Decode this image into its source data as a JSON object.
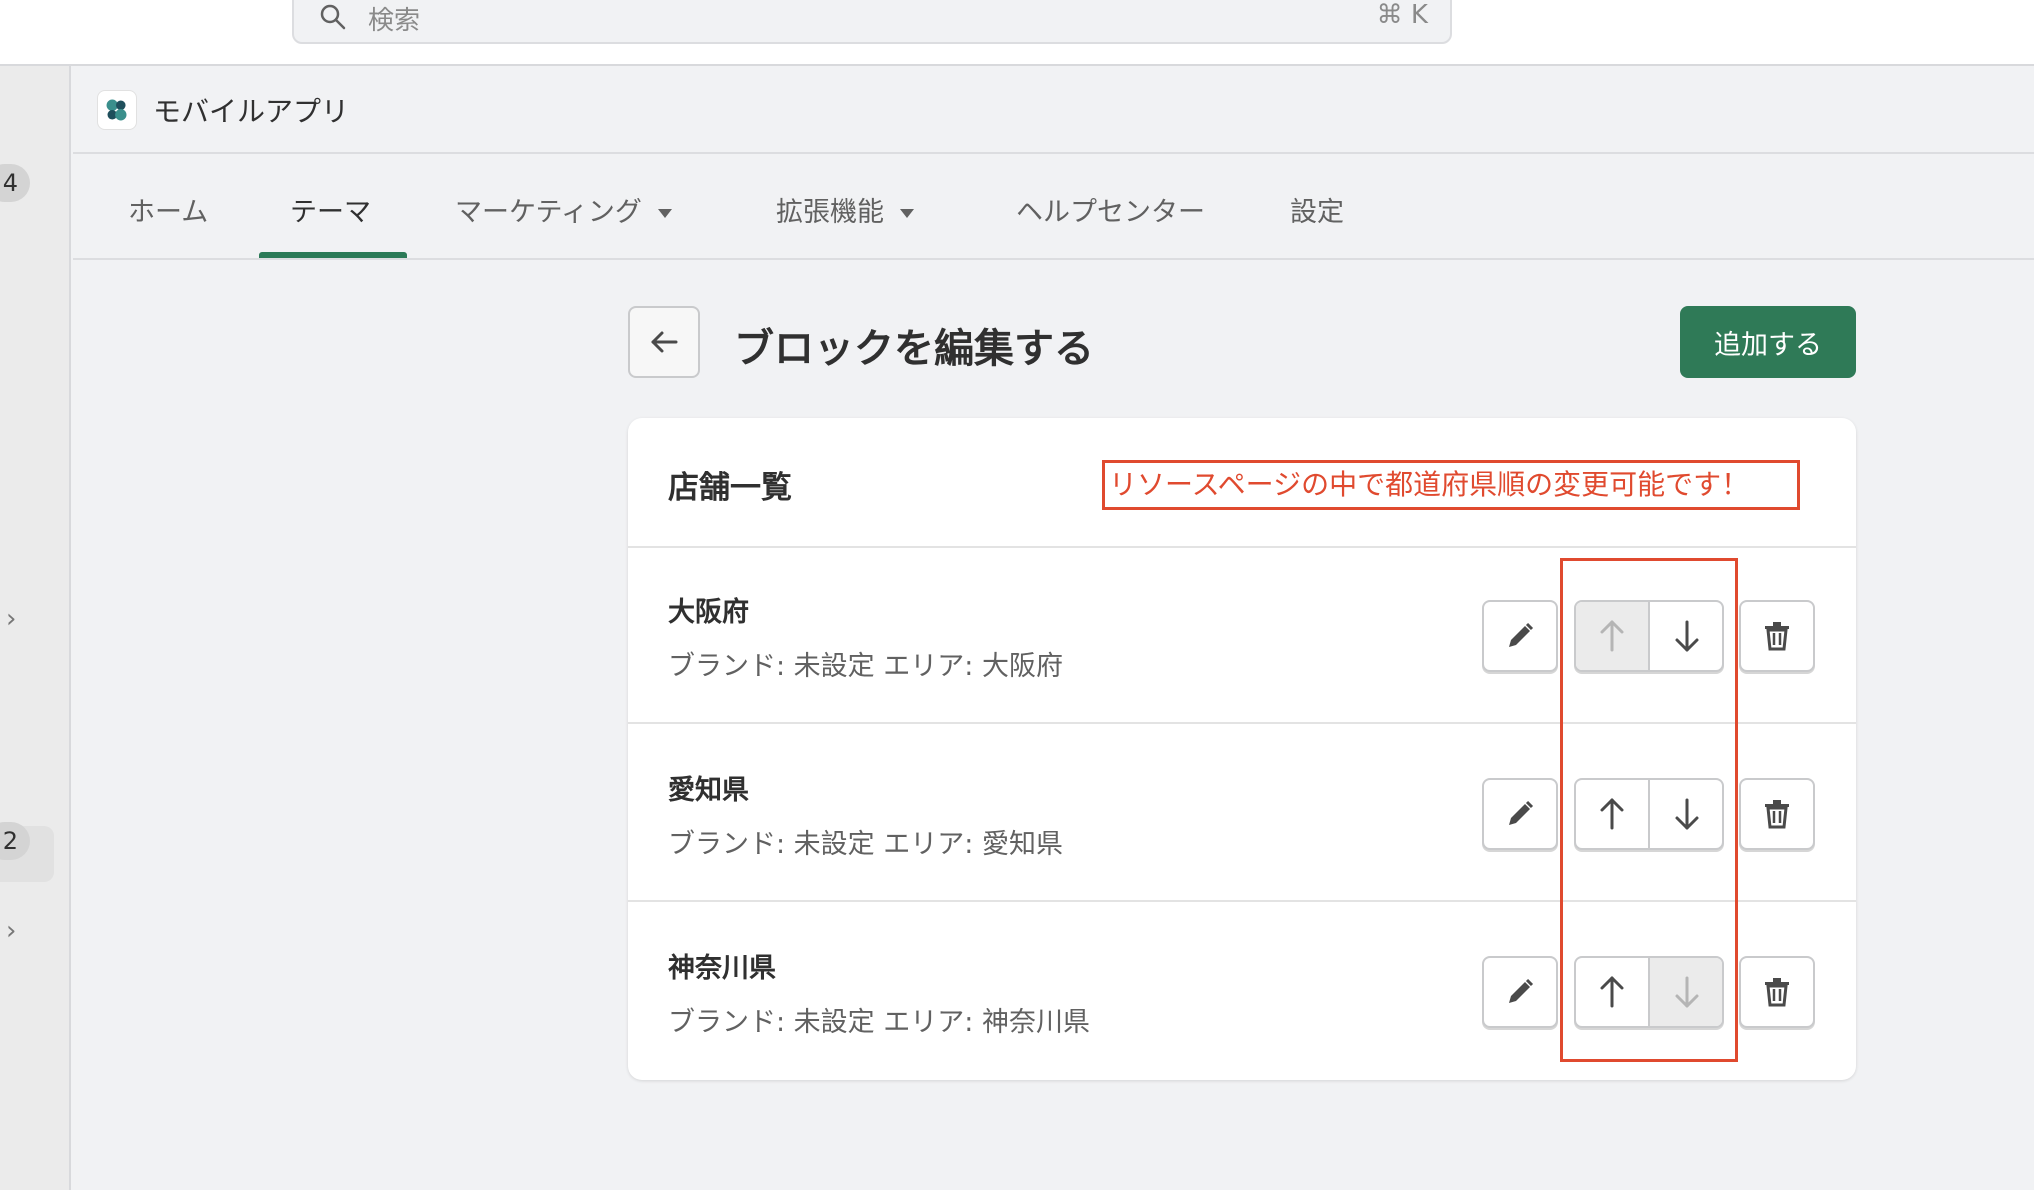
{
  "search": {
    "placeholder": "検索",
    "shortcut": "⌘ K"
  },
  "sidebar": {
    "badges": [
      "4",
      "2"
    ]
  },
  "app": {
    "title": "モバイルアプリ"
  },
  "tabs": [
    {
      "label": "ホーム",
      "active": false,
      "dropdown": false
    },
    {
      "label": "テーマ",
      "active": true,
      "dropdown": false
    },
    {
      "label": "マーケティング",
      "active": false,
      "dropdown": true
    },
    {
      "label": "拡張機能",
      "active": false,
      "dropdown": true
    },
    {
      "label": "ヘルプセンター",
      "active": false,
      "dropdown": false
    },
    {
      "label": "設定",
      "active": false,
      "dropdown": false
    }
  ],
  "page": {
    "title": "ブロックを編集する",
    "add_label": "追加する"
  },
  "card": {
    "title": "店舗一覧",
    "annotation": "リソースページの中で都道府県順の変更可能です！",
    "rows": [
      {
        "name": "大阪府",
        "detail": "ブランド: 未設定  エリア: 大阪府",
        "up_enabled": false,
        "down_enabled": true
      },
      {
        "name": "愛知県",
        "detail": "ブランド: 未設定  エリア: 愛知県",
        "up_enabled": true,
        "down_enabled": true
      },
      {
        "name": "神奈川県",
        "detail": "ブランド: 未設定  エリア: 神奈川県",
        "up_enabled": true,
        "down_enabled": false
      }
    ]
  },
  "colors": {
    "accent": "#2f7a57",
    "annotation": "#e04a2f"
  }
}
